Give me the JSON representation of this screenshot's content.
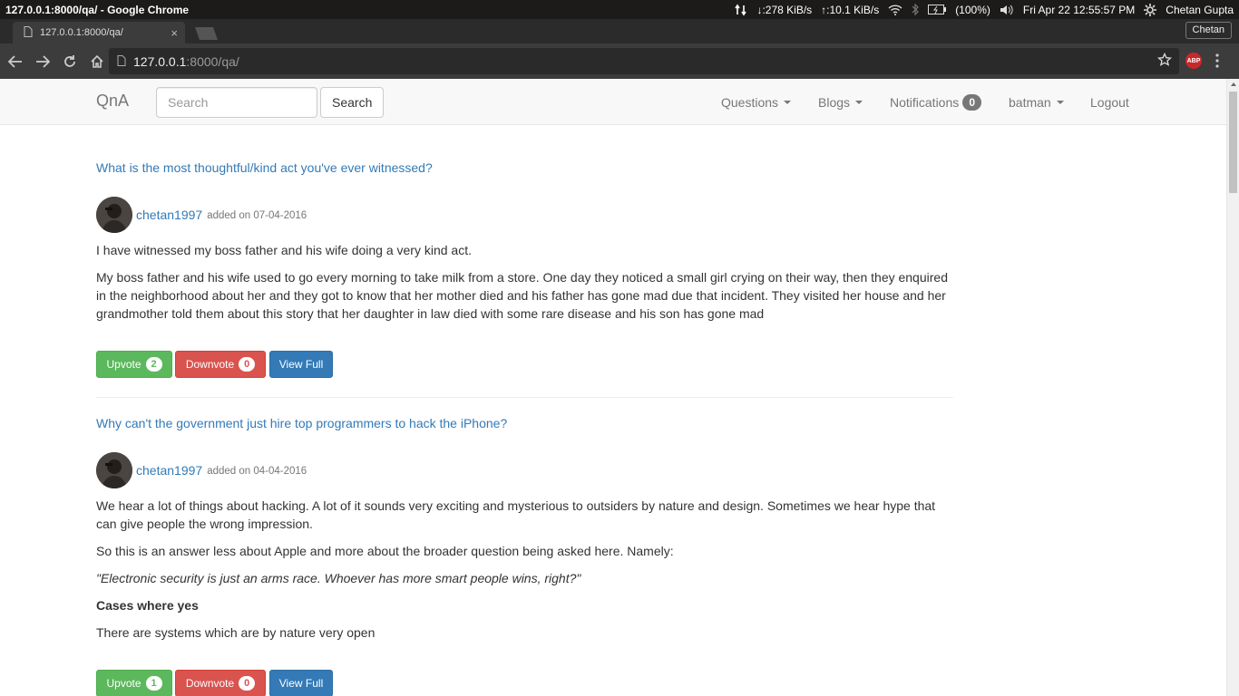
{
  "os_bar": {
    "window_title": "127.0.0.1:8000/qa/ - Google Chrome",
    "download_speed": "↓:278 KiB/s",
    "upload_speed": "↑:10.1 KiB/s",
    "battery": "(100%)",
    "datetime": "Fri Apr 22 12:55:57 PM",
    "user": "Chetan Gupta"
  },
  "browser": {
    "tab_label": "127.0.0.1:8000/qa/",
    "tab_close": "×",
    "profile_name": "Chetan",
    "url_host": "127.0.0.1",
    "url_path": ":8000/qa/",
    "abp_label": "ABP"
  },
  "navbar": {
    "brand": "QnA",
    "search_placeholder": "Search",
    "search_button": "Search",
    "questions": "Questions",
    "blogs": "Blogs",
    "notifications": "Notifications",
    "notifications_count": "0",
    "user": "batman",
    "logout": "Logout"
  },
  "posts": [
    {
      "title": "What is the most thoughtful/kind act you've ever witnessed?",
      "author": "chetan1997",
      "added_on": "added on 07-04-2016",
      "paragraphs": [
        "I have witnessed my boss father and his wife doing a very kind act.",
        "My boss father and his wife used to go every morning to take milk from a store. One day they noticed a small girl crying on their way, then they enquired in the neighborhood about her and they got to know that her mother died and his father has gone mad due that incident. They visited her house and her grandmother told them about this story that her daughter in law died with some rare disease and his son has gone mad"
      ],
      "upvote_label": "Upvote",
      "upvotes": "2",
      "downvote_label": "Downvote",
      "downvotes": "0",
      "view_label": "View Full"
    },
    {
      "title": "Why can't the government just hire top programmers to hack the iPhone?",
      "author": "chetan1997",
      "added_on": "added on 04-04-2016",
      "paragraphs": [
        "We hear a lot of things about hacking. A lot of it sounds very exciting and mysterious to outsiders by nature and design. Sometimes we hear hype that can give people the wrong impression.",
        "So this is an answer less about Apple and more about the broader question being asked here. Namely:",
        "\"Electronic security is just an arms race. Whoever has more smart people wins, right?\"",
        "Cases where yes",
        "There are systems which are by nature very open"
      ],
      "upvote_label": "Upvote",
      "upvotes": "1",
      "downvote_label": "Downvote",
      "downvotes": "0",
      "view_label": "View Full"
    }
  ]
}
